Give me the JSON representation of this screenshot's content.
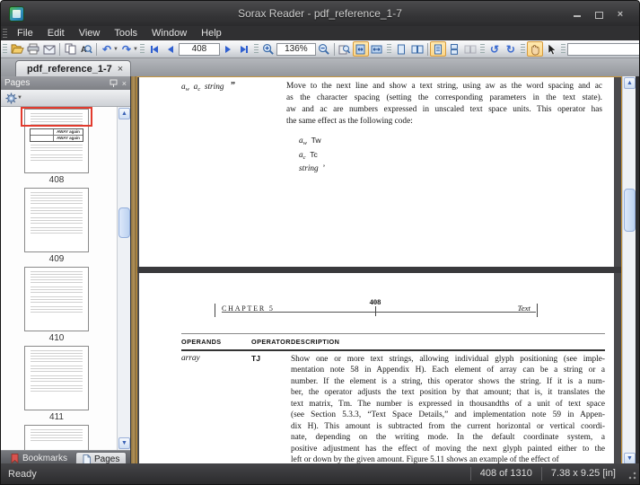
{
  "window": {
    "title": "Sorax Reader - pdf_reference_1-7",
    "close_glyph": "×"
  },
  "menu": {
    "items": [
      "File",
      "Edit",
      "View",
      "Tools",
      "Window",
      "Help"
    ]
  },
  "toolbar": {
    "page_number": "408",
    "zoom_level": "136%",
    "search_value": ""
  },
  "tab": {
    "label": "pdf_reference_1-7",
    "close_glyph": "×"
  },
  "sidebar": {
    "title": "Pages",
    "close_glyph": "×",
    "thumbnails": [
      {
        "page": "408"
      },
      {
        "page": "409"
      },
      {
        "page": "410"
      },
      {
        "page": "411"
      }
    ],
    "sample_text": "AWAY again",
    "tabs": {
      "bookmarks": "Bookmarks",
      "pages": "Pages"
    }
  },
  "statusbar": {
    "status": "Ready",
    "page_indicator": "408 of 1310",
    "page_size": "7.38 x 9.25 [in]"
  },
  "document": {
    "page_top": {
      "operand": {
        "a1": "a",
        "sub1": "w",
        "a2": "a",
        "sub2": "c",
        "word": "string",
        "operator": "”"
      },
      "paragraph_lines": [
        "Move to the next line and show a text string, using aw as the word spacing and ac",
        "as the character spacing (setting the corresponding parameters in the text state).",
        "aw and ac are numbers expressed in unscaled text space units. This operator has",
        "the same effect as the following code:"
      ],
      "code": {
        "a1": "a",
        "sub1": "w",
        "op1": "Tw",
        "a2": "a",
        "sub2": "c",
        "op2": "Tc",
        "word": "string",
        "op3": "’"
      }
    },
    "page_bottom": {
      "header": {
        "chapter": "CHAPTER 5",
        "page_number": "408",
        "section": "Text"
      },
      "table_headers": [
        "OPERANDS",
        "OPERATOR",
        "DESCRIPTION"
      ],
      "row": {
        "operands": "array",
        "operator": "TJ",
        "description_lines": [
          "Show one or more text strings, allowing individual glyph positioning (see imple-",
          "mentation note 58 in Appendix H). Each element of array can be a string or a",
          "number. If the element is a string, this operator shows the string. If it is a num-",
          "ber, the operator adjusts the text position by that amount; that is, it translates the",
          "text matrix, Tm. The number is expressed in thousandths of a unit of text space",
          "(see Section 5.3.3, “Text Space Details,” and implementation note 59 in Appen-",
          "dix H). This amount is subtracted from the current horizontal or vertical coordi-",
          "nate, depending on the writing mode. In the default coordinate system, a",
          "positive adjustment has the effect of moving the next glyph painted either to the",
          "left or down by the given amount. Figure 5.11 shows an example of the effect of"
        ]
      }
    }
  },
  "colors": {
    "accent_amber": "#c6953e",
    "selection_red": "#e23b2e",
    "button_highlight": "#fcd688"
  }
}
